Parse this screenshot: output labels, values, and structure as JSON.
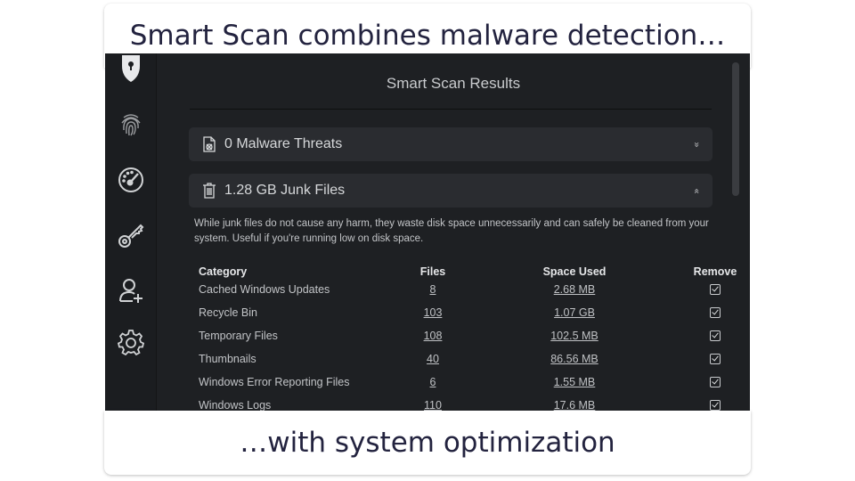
{
  "captions": {
    "top": "Smart Scan combines malware detection…",
    "bottom": "…with system optimization"
  },
  "sidebar": {
    "items": [
      {
        "name": "shield",
        "icon": "shield-icon"
      },
      {
        "name": "fingerprint",
        "icon": "fingerprint-icon"
      },
      {
        "name": "speedometer",
        "icon": "speedometer-icon"
      },
      {
        "name": "key",
        "icon": "key-icon"
      },
      {
        "name": "add-user",
        "icon": "add-user-icon"
      },
      {
        "name": "settings",
        "icon": "gear-icon"
      }
    ]
  },
  "main": {
    "title": "Smart Scan Results",
    "sections": [
      {
        "label": "0 Malware Threats",
        "icon": "file-bug-icon",
        "state": "collapsed",
        "chevron": "»"
      },
      {
        "label": "1.28 GB Junk Files",
        "icon": "trash-icon",
        "state": "expanded",
        "chevron": "«"
      }
    ],
    "description": "While junk files do not cause any harm, they waste disk space unnecessarily and can safely be cleaned from your system. Useful if you're running low on disk space.",
    "table": {
      "headers": {
        "category": "Category",
        "files": "Files",
        "space": "Space Used",
        "remove": "Remove"
      },
      "rows": [
        {
          "category": "Cached Windows Updates",
          "files": "8",
          "space": "2.68 MB",
          "remove": true
        },
        {
          "category": "Recycle Bin",
          "files": "103",
          "space": "1.07 GB",
          "remove": true
        },
        {
          "category": "Temporary Files",
          "files": "108",
          "space": "102.5 MB",
          "remove": true
        },
        {
          "category": "Thumbnails",
          "files": "40",
          "space": "86.56 MB",
          "remove": true
        },
        {
          "category": "Windows Error Reporting Files",
          "files": "6",
          "space": "1.55 MB",
          "remove": true
        },
        {
          "category": "Windows Logs",
          "files": "110",
          "space": "17.6 MB",
          "remove": true
        }
      ]
    }
  },
  "colors": {
    "app_bg": "#1e2023",
    "panel_bg": "#2a2c30",
    "caption_text": "#23233f"
  }
}
